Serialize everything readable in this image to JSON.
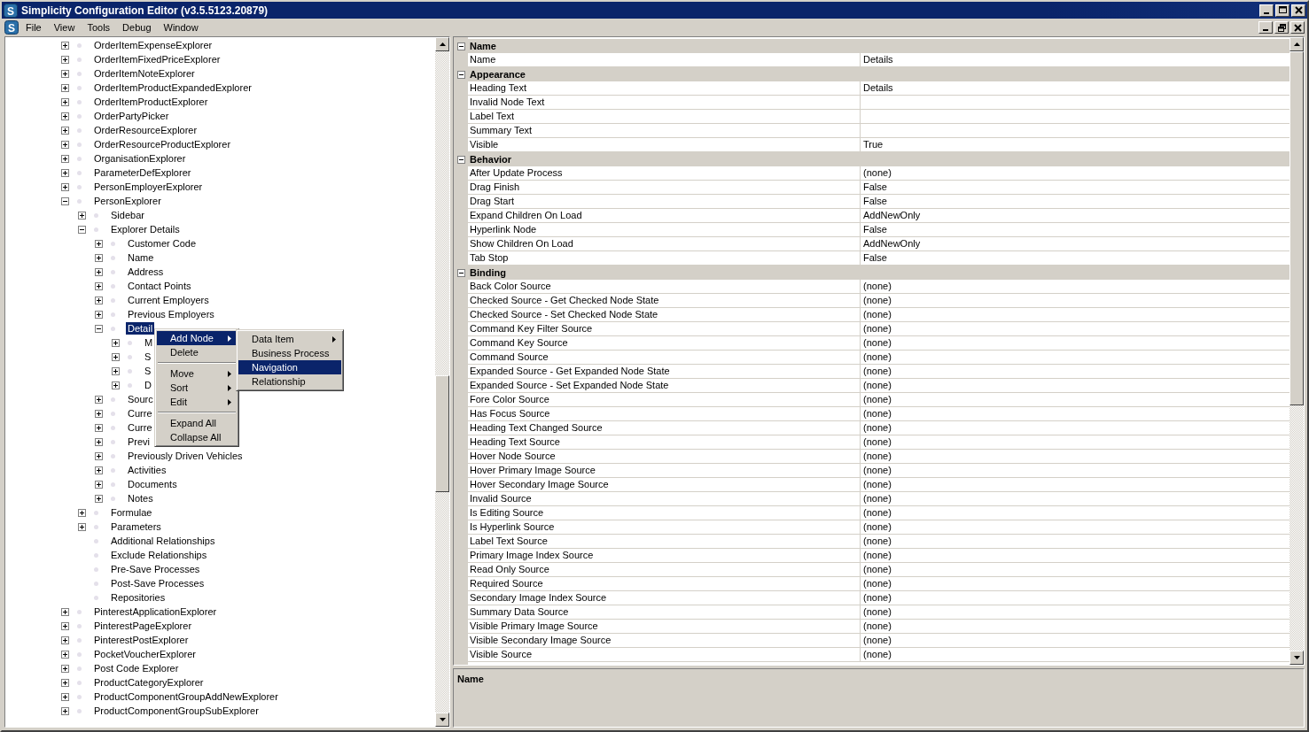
{
  "window": {
    "icon_letter": "S",
    "title": "Simplicity Configuration Editor (v3.5.5123.20879)"
  },
  "menu_logo_letter": "S",
  "menu_bar": [
    "File",
    "View",
    "Tools",
    "Debug",
    "Window"
  ],
  "tree": [
    {
      "label": "OrderItemExpenseExplorer",
      "expanded": false,
      "selected": false
    },
    {
      "label": "OrderItemFixedPriceExplorer",
      "expanded": false,
      "selected": false
    },
    {
      "label": "OrderItemNoteExplorer",
      "expanded": false,
      "selected": false
    },
    {
      "label": "OrderItemProductExpandedExplorer",
      "expanded": false,
      "selected": false
    },
    {
      "label": "OrderItemProductExplorer",
      "expanded": false,
      "selected": false
    },
    {
      "label": "OrderPartyPicker",
      "expanded": false,
      "selected": false
    },
    {
      "label": "OrderResourceExplorer",
      "expanded": false,
      "selected": false
    },
    {
      "label": "OrderResourceProductExplorer",
      "expanded": false,
      "selected": false
    },
    {
      "label": "OrganisationExplorer",
      "expanded": false,
      "selected": false
    },
    {
      "label": "ParameterDefExplorer",
      "expanded": false,
      "selected": false
    },
    {
      "label": "PersonEmployerExplorer",
      "expanded": false,
      "selected": false
    },
    {
      "label": "PersonExplorer",
      "expanded": true,
      "selected": false,
      "children": [
        {
          "label": "Sidebar",
          "expanded": false,
          "selected": false
        },
        {
          "label": "Explorer Details",
          "expanded": true,
          "selected": false,
          "children": [
            {
              "label": "Customer Code",
              "expanded": false,
              "selected": false
            },
            {
              "label": "Name",
              "expanded": false,
              "selected": false
            },
            {
              "label": "Address",
              "expanded": false,
              "selected": false
            },
            {
              "label": "Contact Points",
              "expanded": false,
              "selected": false
            },
            {
              "label": "Current Employers",
              "expanded": false,
              "selected": false
            },
            {
              "label": "Previous Employers",
              "expanded": false,
              "selected": false
            },
            {
              "label": "Detail",
              "expanded": true,
              "selected": true,
              "children": [
                {
                  "label": "M",
                  "expanded": false,
                  "selected": false
                },
                {
                  "label": "S",
                  "expanded": false,
                  "selected": false
                },
                {
                  "label": "S",
                  "expanded": false,
                  "selected": false
                },
                {
                  "label": "D",
                  "expanded": false,
                  "selected": false
                }
              ]
            },
            {
              "label": "Sourc",
              "expanded": false,
              "selected": false
            },
            {
              "label": "Curre",
              "expanded": false,
              "selected": false
            },
            {
              "label": "Curre",
              "expanded": false,
              "selected": false
            },
            {
              "label": "Previ",
              "expanded": false,
              "selected": false
            },
            {
              "label": "Previously Driven Vehicles",
              "expanded": false,
              "selected": false
            },
            {
              "label": "Activities",
              "expanded": false,
              "selected": false
            },
            {
              "label": "Documents",
              "expanded": false,
              "selected": false
            },
            {
              "label": "Notes",
              "expanded": false,
              "selected": false
            }
          ]
        },
        {
          "label": "Formulae",
          "expanded": false,
          "selected": false
        },
        {
          "label": "Parameters",
          "expanded": false,
          "selected": false
        },
        {
          "label": "Additional Relationships",
          "selected": false
        },
        {
          "label": "Exclude Relationships",
          "selected": false
        },
        {
          "label": "Pre-Save Processes",
          "selected": false
        },
        {
          "label": "Post-Save Processes",
          "selected": false
        },
        {
          "label": "Repositories",
          "selected": false
        }
      ]
    },
    {
      "label": "PinterestApplicationExplorer",
      "expanded": false,
      "selected": false
    },
    {
      "label": "PinterestPageExplorer",
      "expanded": false,
      "selected": false
    },
    {
      "label": "PinterestPostExplorer",
      "expanded": false,
      "selected": false
    },
    {
      "label": "PocketVoucherExplorer",
      "expanded": false,
      "selected": false
    },
    {
      "label": "Post Code Explorer",
      "expanded": false,
      "selected": false
    },
    {
      "label": "ProductCategoryExplorer",
      "expanded": false,
      "selected": false
    },
    {
      "label": "ProductComponentGroupAddNewExplorer",
      "expanded": false,
      "selected": false
    },
    {
      "label": "ProductComponentGroupSubExplorer",
      "expanded": false,
      "selected": false
    }
  ],
  "context_menu": [
    {
      "kind": "item",
      "label": "Add Node",
      "submenu": true,
      "selected": true
    },
    {
      "kind": "item",
      "label": "Delete",
      "submenu": false,
      "selected": false
    },
    {
      "kind": "separator"
    },
    {
      "kind": "item",
      "label": "Move",
      "submenu": true,
      "selected": false
    },
    {
      "kind": "item",
      "label": "Sort",
      "submenu": true,
      "selected": false
    },
    {
      "kind": "item",
      "label": "Edit",
      "submenu": true,
      "selected": false
    },
    {
      "kind": "separator"
    },
    {
      "kind": "item",
      "label": "Expand All",
      "submenu": false,
      "selected": false
    },
    {
      "kind": "item",
      "label": "Collapse All",
      "submenu": false,
      "selected": false
    }
  ],
  "submenu": [
    {
      "kind": "item",
      "label": "Data Item",
      "submenu": true,
      "selected": false
    },
    {
      "kind": "item",
      "label": "Business Process",
      "submenu": false,
      "selected": false
    },
    {
      "kind": "item",
      "label": "Navigation",
      "submenu": false,
      "selected": true
    },
    {
      "kind": "item",
      "label": "Relationship",
      "submenu": false,
      "selected": false
    }
  ],
  "property_grid": {
    "categories": [
      {
        "name": "Name",
        "expanded": true,
        "properties": [
          {
            "name": "Name",
            "value": "Details"
          }
        ]
      },
      {
        "name": "Appearance",
        "expanded": true,
        "properties": [
          {
            "name": "Heading Text",
            "value": "Details"
          },
          {
            "name": "Invalid Node Text"
          },
          {
            "name": "Label Text"
          },
          {
            "name": "Summary Text"
          },
          {
            "name": "Visible",
            "value": "True"
          }
        ]
      },
      {
        "name": "Behavior",
        "expanded": true,
        "properties": [
          {
            "name": "After Update Process",
            "value": "(none)"
          },
          {
            "name": "Drag Finish",
            "value": "False"
          },
          {
            "name": "Drag Start",
            "value": "False"
          },
          {
            "name": "Expand Children On Load",
            "value": "AddNewOnly"
          },
          {
            "name": "Hyperlink Node",
            "value": "False"
          },
          {
            "name": "Show Children On Load",
            "value": "AddNewOnly"
          },
          {
            "name": "Tab Stop",
            "value": "False"
          }
        ]
      },
      {
        "name": "Binding",
        "expanded": true,
        "properties": [
          {
            "name": "Back Color Source",
            "value": "(none)"
          },
          {
            "name": "Checked Source - Get Checked Node State",
            "value": "(none)"
          },
          {
            "name": "Checked Source - Set Checked Node State",
            "value": "(none)"
          },
          {
            "name": "Command Key Filter Source",
            "value": "(none)"
          },
          {
            "name": "Command Key Source",
            "value": "(none)"
          },
          {
            "name": "Command Source",
            "value": "(none)"
          },
          {
            "name": "Expanded Source - Get Expanded Node State",
            "value": "(none)"
          },
          {
            "name": "Expanded Source - Set Expanded Node State",
            "value": "(none)"
          },
          {
            "name": "Fore Color Source",
            "value": "(none)"
          },
          {
            "name": "Has Focus Source",
            "value": "(none)"
          },
          {
            "name": "Heading Text Changed Source",
            "value": "(none)"
          },
          {
            "name": "Heading Text Source",
            "value": "(none)"
          },
          {
            "name": "Hover Node Source",
            "value": "(none)"
          },
          {
            "name": "Hover Primary Image Source",
            "value": "(none)"
          },
          {
            "name": "Hover Secondary Image Source",
            "value": "(none)"
          },
          {
            "name": "Invalid Source",
            "value": "(none)"
          },
          {
            "name": "Is Editing Source",
            "value": "(none)"
          },
          {
            "name": "Is Hyperlink Source",
            "value": "(none)"
          },
          {
            "name": "Label Text Source",
            "value": "(none)"
          },
          {
            "name": "Primary Image Index Source",
            "value": "(none)"
          },
          {
            "name": "Read Only Source",
            "value": "(none)"
          },
          {
            "name": "Required Source",
            "value": "(none)"
          },
          {
            "name": "Secondary Image Index Source",
            "value": "(none)"
          },
          {
            "name": "Summary Data Source",
            "value": "(none)"
          },
          {
            "name": "Visible Primary Image Source",
            "value": "(none)"
          },
          {
            "name": "Visible Secondary Image Source",
            "value": "(none)"
          },
          {
            "name": "Visible Source",
            "value": "(none)"
          }
        ]
      }
    ]
  },
  "description": {
    "title": "Name"
  }
}
